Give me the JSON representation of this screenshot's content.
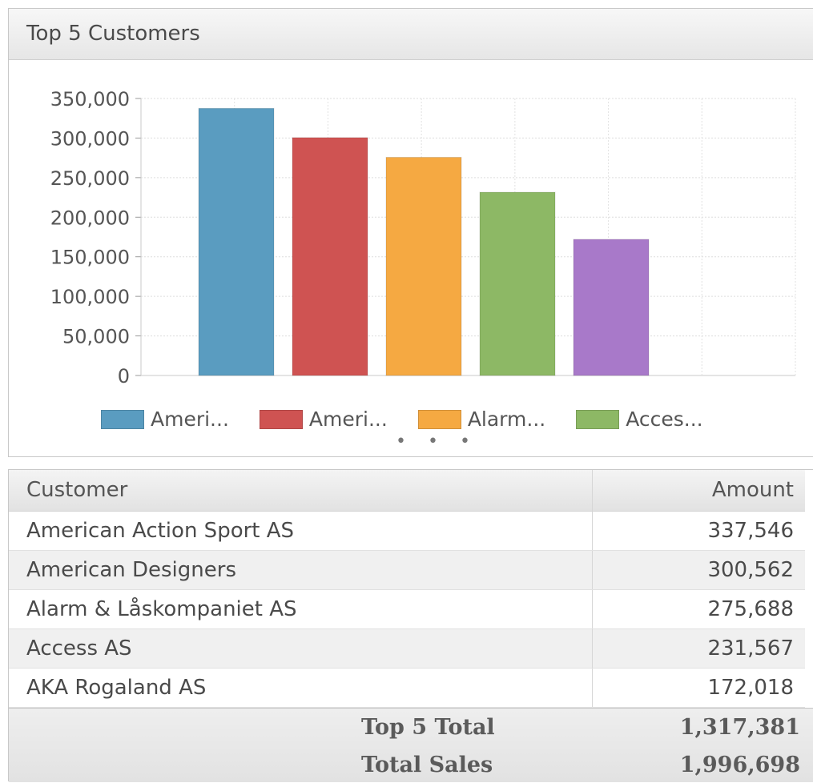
{
  "widget": {
    "title": "Top 5 Customers"
  },
  "chart_data": {
    "type": "bar",
    "categories": [
      "American Action Sport AS",
      "American Designers",
      "Alarm & Låskompaniet AS",
      "Access AS",
      "AKA Rogaland AS"
    ],
    "values": [
      337546,
      300562,
      275688,
      231567,
      172018
    ],
    "colors": [
      "#5a9cc0",
      "#cf5352",
      "#f5a942",
      "#8db865",
      "#a879c9"
    ],
    "ylim": [
      0,
      350000
    ],
    "yticks": [
      "0",
      "50,000",
      "100,000",
      "150,000",
      "200,000",
      "250,000",
      "300,000",
      "350,000"
    ],
    "grid": true,
    "legend_position": "bottom"
  },
  "legend": {
    "items": [
      {
        "label": "Ameri...",
        "color": "#5a9cc0"
      },
      {
        "label": "Ameri...",
        "color": "#cf5352"
      },
      {
        "label": "Alarm...",
        "color": "#f5a942"
      },
      {
        "label": "Acces...",
        "color": "#8db865"
      }
    ],
    "more": "• • •"
  },
  "table": {
    "headers": {
      "customer": "Customer",
      "amount": "Amount"
    },
    "rows": [
      {
        "customer": "American Action Sport AS",
        "amount": "337,546"
      },
      {
        "customer": "American Designers",
        "amount": "300,562"
      },
      {
        "customer": "Alarm & Låskompaniet AS",
        "amount": "275,688"
      },
      {
        "customer": "Access AS",
        "amount": "231,567"
      },
      {
        "customer": "AKA Rogaland AS",
        "amount": "172,018"
      }
    ],
    "totals": [
      {
        "label": "Top 5 Total",
        "value": "1,317,381"
      },
      {
        "label": "Total Sales",
        "value": "1,996,698"
      }
    ]
  }
}
